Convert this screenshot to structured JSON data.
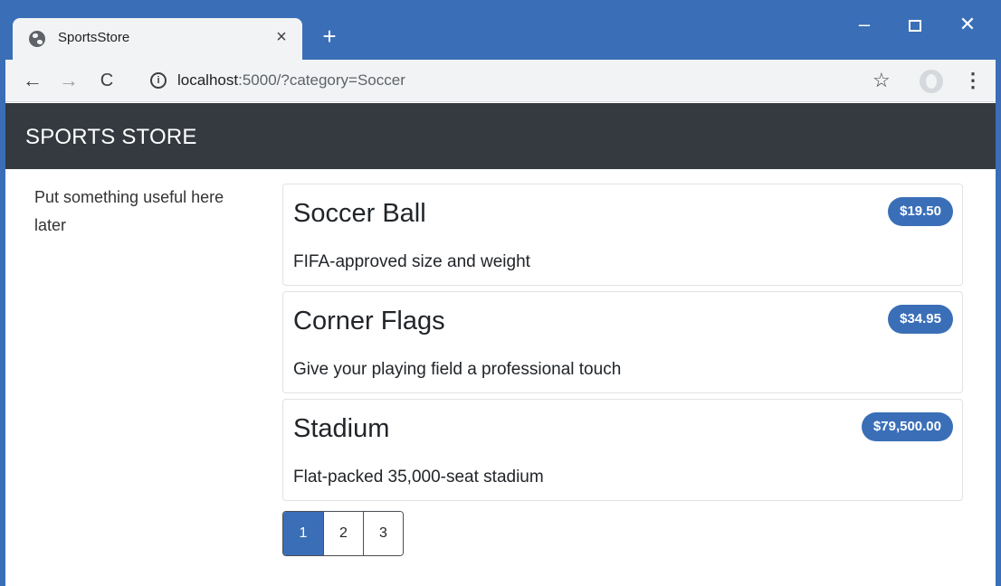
{
  "browser": {
    "tab_title": "SportsStore",
    "tab_close": "×",
    "new_tab": "+",
    "window_min": "–",
    "window_close": "✕",
    "back": "←",
    "forward": "→",
    "reload": "C",
    "info": "i",
    "url_host": "localhost",
    "url_path": ":5000/?category=Soccer",
    "star": "☆",
    "menu": "⋮"
  },
  "header": {
    "brand": "SPORTS STORE"
  },
  "sidebar": {
    "note": "Put something useful here later"
  },
  "products": [
    {
      "name": "Soccer Ball",
      "price": "$19.50",
      "description": "FIFA-approved size and weight"
    },
    {
      "name": "Corner Flags",
      "price": "$34.95",
      "description": "Give your playing field a professional touch"
    },
    {
      "name": "Stadium",
      "price": "$79,500.00",
      "description": "Flat-packed 35,000-seat stadium"
    }
  ],
  "pagination": {
    "pages": [
      "1",
      "2",
      "3"
    ],
    "active": "1"
  },
  "colors": {
    "accent": "#3a6fb8",
    "navbar": "#343a40"
  }
}
